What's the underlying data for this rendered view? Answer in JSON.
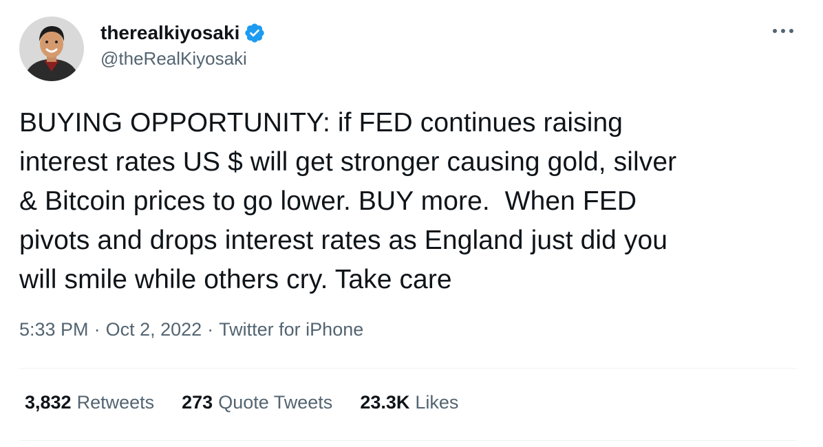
{
  "author": {
    "display_name": "therealkiyosaki",
    "handle": "@theRealKiyosaki",
    "verified_icon": "verified-badge-icon",
    "avatar": "profile-photo"
  },
  "tweet": {
    "text": "BUYING OPPORTUNITY: if FED continues raising\ninterest rates US $ will get stronger causing gold, silver\n& Bitcoin prices to go lower. BUY more.  When FED\npivots and drops interest rates as England just did you\nwill smile while others cry. Take care"
  },
  "meta": {
    "time": "5:33 PM",
    "sep1": "·",
    "date": "Oct 2, 2022",
    "sep2": "·",
    "source": "Twitter for iPhone"
  },
  "stats": {
    "retweets": {
      "count": "3,832",
      "label": "Retweets"
    },
    "quotes": {
      "count": "273",
      "label": "Quote Tweets"
    },
    "likes": {
      "count": "23.3K",
      "label": "Likes"
    }
  },
  "colors": {
    "verified": "#1d9bf0",
    "text": "#0f1419",
    "secondary": "#536471",
    "divider": "#eff3f4"
  },
  "icons": {
    "more": "more-dots-icon"
  }
}
